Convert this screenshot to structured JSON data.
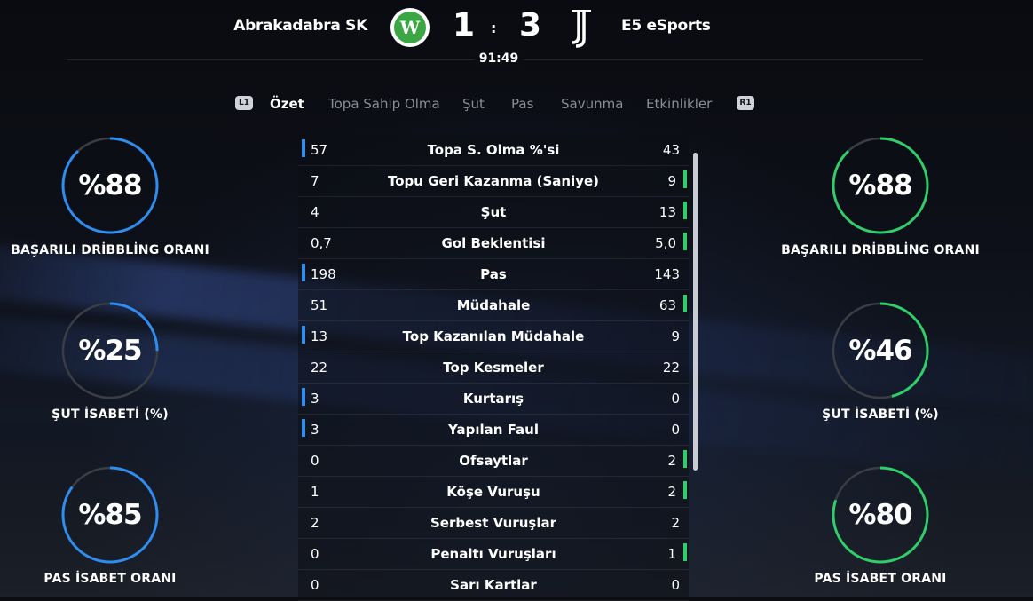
{
  "header": {
    "home_team": "Abrakadabra SK",
    "away_team": "E5 eSports",
    "home_logo_letter": "W",
    "home_score": "1",
    "separator": ":",
    "away_score": "3",
    "clock": "91:49"
  },
  "tabs": {
    "left_button": "L1",
    "right_button": "R1",
    "items": [
      "Özet",
      "Topa Sahip Olma",
      "Şut",
      "Pas",
      "Savunma",
      "Etkinlikler"
    ],
    "active": "Özet"
  },
  "colors": {
    "home": "#2f8df0",
    "away": "#2fce6a",
    "ring_track": "#3a3d44"
  },
  "home_rings": [
    {
      "value": "%88",
      "label": "BAŞARILI DRİBBLİNG ORANI",
      "percent": 88
    },
    {
      "value": "%25",
      "label": "ŞUT İSABETİ (%)",
      "percent": 25
    },
    {
      "value": "%85",
      "label": "PAS İSABET ORANI",
      "percent": 85
    }
  ],
  "away_rings": [
    {
      "value": "%88",
      "label": "BAŞARILI DRİBBLİNG ORANI",
      "percent": 88
    },
    {
      "value": "%46",
      "label": "ŞUT İSABETİ (%)",
      "percent": 46
    },
    {
      "value": "%80",
      "label": "PAS İSABET ORANI",
      "percent": 80
    }
  ],
  "stats": [
    {
      "name": "Topa S. Olma %'si",
      "home": "57",
      "away": "43",
      "leader": "home"
    },
    {
      "name": "Topu Geri Kazanma (Saniye)",
      "home": "7",
      "away": "9",
      "leader": "away"
    },
    {
      "name": "Şut",
      "home": "4",
      "away": "13",
      "leader": "away"
    },
    {
      "name": "Gol Beklentisi",
      "home": "0,7",
      "away": "5,0",
      "leader": "away"
    },
    {
      "name": "Pas",
      "home": "198",
      "away": "143",
      "leader": "home"
    },
    {
      "name": "Müdahale",
      "home": "51",
      "away": "63",
      "leader": "away"
    },
    {
      "name": "Top Kazanılan Müdahale",
      "home": "13",
      "away": "9",
      "leader": "home"
    },
    {
      "name": "Top Kesmeler",
      "home": "22",
      "away": "22",
      "leader": "none"
    },
    {
      "name": "Kurtarış",
      "home": "3",
      "away": "0",
      "leader": "home"
    },
    {
      "name": "Yapılan Faul",
      "home": "3",
      "away": "0",
      "leader": "home"
    },
    {
      "name": "Ofsaytlar",
      "home": "0",
      "away": "2",
      "leader": "away"
    },
    {
      "name": "Köşe Vuruşu",
      "home": "1",
      "away": "2",
      "leader": "away"
    },
    {
      "name": "Serbest Vuruşlar",
      "home": "2",
      "away": "2",
      "leader": "none"
    },
    {
      "name": "Penaltı Vuruşları",
      "home": "0",
      "away": "1",
      "leader": "away"
    },
    {
      "name": "Sarı Kartlar",
      "home": "0",
      "away": "0",
      "leader": "none"
    }
  ]
}
